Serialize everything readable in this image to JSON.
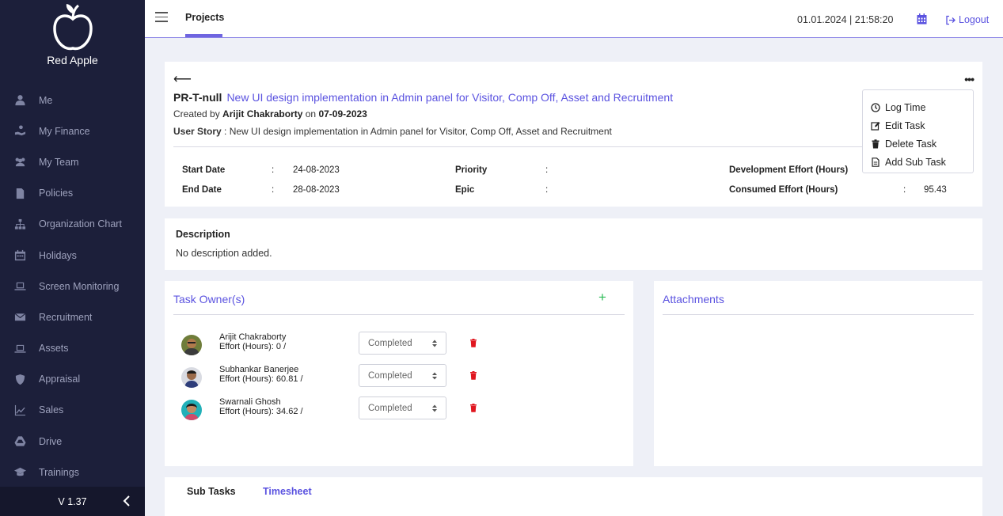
{
  "sidebar": {
    "brand": "Red Apple",
    "items": [
      {
        "label": "Me",
        "icon": "user-icon"
      },
      {
        "label": "My Finance",
        "icon": "finance-icon"
      },
      {
        "label": "My Team",
        "icon": "team-icon"
      },
      {
        "label": "Policies",
        "icon": "file-icon"
      },
      {
        "label": "Organization Chart",
        "icon": "sitemap-icon"
      },
      {
        "label": "Holidays",
        "icon": "calendar-icon"
      },
      {
        "label": "Screen Monitoring",
        "icon": "laptop-icon"
      },
      {
        "label": "Recruitment",
        "icon": "envelope-icon"
      },
      {
        "label": "Assets",
        "icon": "laptop-icon"
      },
      {
        "label": "Appraisal",
        "icon": "shield-icon"
      },
      {
        "label": "Sales",
        "icon": "chart-icon"
      },
      {
        "label": "Drive",
        "icon": "drive-icon"
      },
      {
        "label": "Trainings",
        "icon": "graduation-icon"
      }
    ],
    "version": "V 1.37"
  },
  "topbar": {
    "tab": "Projects",
    "datetime": "01.01.2024  | 21:58:20",
    "logout": "Logout"
  },
  "task": {
    "id": "PR-T-null",
    "name": "New UI design implementation in Admin panel for Visitor, Comp Off, Asset and Recruitment",
    "created_prefix": "Created by",
    "created_by": "Arijit Chakraborty",
    "created_on_prefix": "on",
    "created_on": "07-09-2023",
    "story_label": "User Story",
    "story_text": " : New UI design implementation in Admin panel for Visitor, Comp Off, Asset and Recruitment",
    "start_label": "Start Date",
    "start_value": "24-08-2023",
    "end_label": "End Date",
    "end_value": "28-08-2023",
    "priority_label": "Priority",
    "epic_label": "Epic",
    "dev_effort_label": "Development Effort (Hours)",
    "consumed_label": "Consumed Effort (Hours)",
    "consumed_value": "95.43",
    "colon": ":"
  },
  "menu": {
    "log_time": "Log Time",
    "edit": "Edit Task",
    "delete": "Delete Task",
    "add_sub": "Add Sub Task"
  },
  "description": {
    "title": "Description",
    "text": "No description added."
  },
  "owners": {
    "title": "Task Owner(s)",
    "list": [
      {
        "name": "Arijit Chakraborty",
        "effort": "Effort (Hours): 0 /",
        "status": "Completed"
      },
      {
        "name": "Subhankar Banerjee",
        "effort": "Effort (Hours): 60.81 /",
        "status": "Completed"
      },
      {
        "name": "Swarnali Ghosh",
        "effort": "Effort (Hours): 34.62 /",
        "status": "Completed"
      }
    ]
  },
  "attachments": {
    "title": "Attachments"
  },
  "tabs": {
    "sub_tasks": "Sub Tasks",
    "timesheet": "Timesheet"
  },
  "colors": {
    "accent": "#5b53e0",
    "sidebar": "#1c1f3a",
    "add": "#2bbb55",
    "delete": "#e0161f"
  }
}
